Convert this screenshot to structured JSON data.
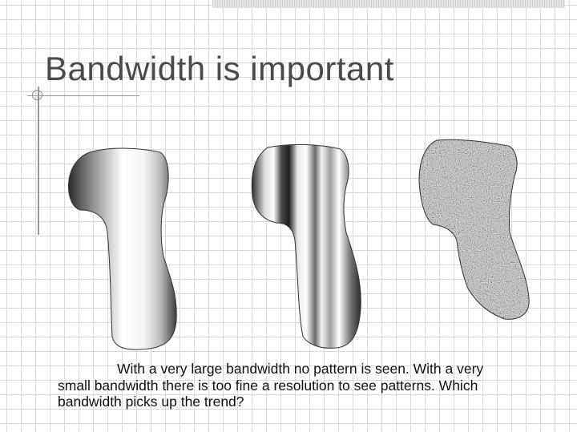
{
  "slide": {
    "title": "Bandwidth is important",
    "caption": "With a very large bandwidth no pattern is seen. With a very small bandwidth there is too fine a resolution to see patterns. Which bandwidth picks up the trend?"
  },
  "figures": [
    {
      "name": "large-bandwidth-shape",
      "fill": "smooth-gradient"
    },
    {
      "name": "medium-bandwidth-shape",
      "fill": "vertical-bands"
    },
    {
      "name": "small-bandwidth-shape",
      "fill": "noise-speckle"
    }
  ],
  "colors": {
    "title": "#4a4a4a",
    "grid": "#d9d9d9",
    "outline": "#333333",
    "speckle_base": "#9a9a9a"
  }
}
